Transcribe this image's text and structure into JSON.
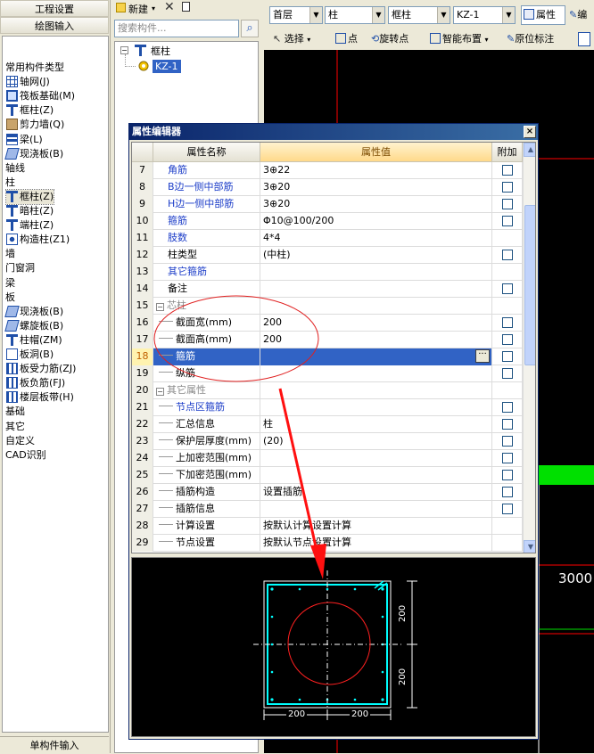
{
  "left_panel": {
    "top_buttons": [
      "工程设置",
      "绘图输入"
    ],
    "bottom_button": "单构件输入",
    "tree": [
      {
        "label": "常用构件类型",
        "level": 0,
        "icon": "none"
      },
      {
        "label": "轴网(J)",
        "level": 1,
        "icon": "grid-icon"
      },
      {
        "label": "筏板基础(M)",
        "level": 1,
        "icon": "raft-foundation-icon"
      },
      {
        "label": "框柱(Z)",
        "level": 1,
        "icon": "frame-column-icon"
      },
      {
        "label": "剪力墙(Q)",
        "level": 1,
        "icon": "shear-wall-icon"
      },
      {
        "label": "梁(L)",
        "level": 1,
        "icon": "beam-icon"
      },
      {
        "label": "现浇板(B)",
        "level": 1,
        "icon": "slab-icon"
      },
      {
        "label": "轴线",
        "level": 0,
        "icon": "none"
      },
      {
        "label": "柱",
        "level": 0,
        "icon": "none"
      },
      {
        "label": "框柱(Z)",
        "level": 1,
        "icon": "frame-column-icon",
        "selected": true
      },
      {
        "label": "暗柱(Z)",
        "level": 1,
        "icon": "hidden-column-icon"
      },
      {
        "label": "端柱(Z)",
        "level": 1,
        "icon": "end-column-icon"
      },
      {
        "label": "构造柱(Z1)",
        "level": 1,
        "icon": "constructional-column-icon"
      },
      {
        "label": "墙",
        "level": 0,
        "icon": "none"
      },
      {
        "label": "门窗洞",
        "level": 0,
        "icon": "none"
      },
      {
        "label": "梁",
        "level": 0,
        "icon": "none"
      },
      {
        "label": "板",
        "level": 0,
        "icon": "none"
      },
      {
        "label": "现浇板(B)",
        "level": 1,
        "icon": "slab-icon"
      },
      {
        "label": "螺旋板(B)",
        "level": 1,
        "icon": "spiral-slab-icon"
      },
      {
        "label": "柱帽(ZM)",
        "level": 1,
        "icon": "column-cap-icon"
      },
      {
        "label": "板洞(B)",
        "level": 1,
        "icon": "slab-hole-icon"
      },
      {
        "label": "板受力筋(ZJ)",
        "level": 1,
        "icon": "slab-rebar-icon"
      },
      {
        "label": "板负筋(FJ)",
        "level": 1,
        "icon": "slab-negative-rebar-icon"
      },
      {
        "label": "楼层板带(H)",
        "level": 1,
        "icon": "floor-strip-icon"
      },
      {
        "label": "基础",
        "level": 0,
        "icon": "none"
      },
      {
        "label": "其它",
        "level": 0,
        "icon": "none"
      },
      {
        "label": "自定义",
        "level": 0,
        "icon": "none"
      },
      {
        "label": "CAD识别",
        "level": 0,
        "icon": "none"
      }
    ]
  },
  "component_panel": {
    "new_label": "新建",
    "search_placeholder": "搜索构件...",
    "tree_root": "框柱",
    "tree_child": "KZ-1"
  },
  "main_toolbar": {
    "floor": "首层",
    "category": "柱",
    "type": "框柱",
    "component": "KZ-1",
    "property_btn": "属性",
    "edit_btn_partial": "编",
    "buttons": [
      "选择",
      "点",
      "旋转点",
      "智能布置",
      "原位标注"
    ]
  },
  "canvas": {
    "dimension_text": "3000",
    "accent_green": "#00e000",
    "line_red": "#ff0000"
  },
  "property_editor": {
    "title": "属性编辑器",
    "close_label": "×",
    "headers": {
      "num": "",
      "name": "属性名称",
      "value": "属性值",
      "extra": "附加"
    },
    "dots_label": "···",
    "rows": [
      {
        "num": "7",
        "name": "角筋",
        "value": "3⊕22",
        "blue": true,
        "check": true
      },
      {
        "num": "8",
        "name": "B边一侧中部筋",
        "value": "3⊕20",
        "blue": true,
        "check": true
      },
      {
        "num": "9",
        "name": "H边一侧中部筋",
        "value": "3⊕20",
        "blue": true,
        "check": true
      },
      {
        "num": "10",
        "name": "箍筋",
        "value": "Φ10@100/200",
        "blue": true,
        "check": true
      },
      {
        "num": "11",
        "name": "肢数",
        "value": "4*4",
        "blue": true,
        "check": false
      },
      {
        "num": "12",
        "name": "柱类型",
        "value": "(中柱)",
        "blue": false,
        "check": true
      },
      {
        "num": "13",
        "name": "其它箍筋",
        "value": "",
        "blue": true,
        "check": false
      },
      {
        "num": "14",
        "name": "备注",
        "value": "",
        "blue": false,
        "check": true
      },
      {
        "num": "15",
        "name": "芯柱",
        "value": "",
        "group": true,
        "expander": "−",
        "check": false
      },
      {
        "num": "16",
        "name": "截面宽(mm)",
        "value": "200",
        "indent": true,
        "blue": false,
        "check": true
      },
      {
        "num": "17",
        "name": "截面高(mm)",
        "value": "200",
        "indent": true,
        "blue": false,
        "check": true
      },
      {
        "num": "18",
        "name": "箍筋",
        "value": "",
        "indent": true,
        "blue": true,
        "check": true,
        "selected": true
      },
      {
        "num": "19",
        "name": "纵筋",
        "value": "",
        "indent": true,
        "blue": false,
        "check": true
      },
      {
        "num": "20",
        "name": "其它属性",
        "value": "",
        "group": true,
        "expander": "−",
        "check": false
      },
      {
        "num": "21",
        "name": "节点区箍筋",
        "value": "",
        "indent": true,
        "blue": true,
        "check": true
      },
      {
        "num": "22",
        "name": "汇总信息",
        "value": "柱",
        "indent": true,
        "blue": false,
        "check": true
      },
      {
        "num": "23",
        "name": "保护层厚度(mm)",
        "value": "(20)",
        "indent": true,
        "blue": false,
        "check": true
      },
      {
        "num": "24",
        "name": "上加密范围(mm)",
        "value": "",
        "indent": true,
        "blue": false,
        "check": true
      },
      {
        "num": "25",
        "name": "下加密范围(mm)",
        "value": "",
        "indent": true,
        "blue": false,
        "check": true
      },
      {
        "num": "26",
        "name": "插筋构造",
        "value": "设置插筋",
        "indent": true,
        "blue": false,
        "check": true
      },
      {
        "num": "27",
        "name": "插筋信息",
        "value": "",
        "indent": true,
        "blue": false,
        "check": true
      },
      {
        "num": "28",
        "name": "计算设置",
        "value": "按默认计算设置计算",
        "indent": true,
        "blue": false,
        "check": false
      },
      {
        "num": "29",
        "name": "节点设置",
        "value": "按默认节点设置计算",
        "indent": true,
        "blue": false,
        "check": false
      }
    ],
    "preview": {
      "dim_left_top": "200",
      "dim_left_bottom": "200",
      "dim_bottom_left": "200",
      "dim_bottom_right": "200"
    }
  }
}
